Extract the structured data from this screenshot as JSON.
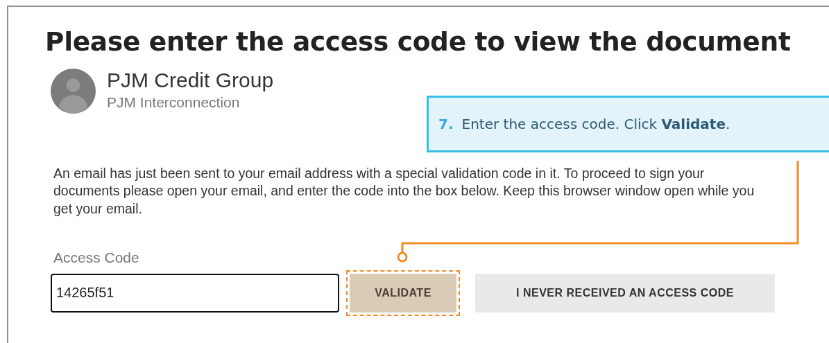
{
  "heading": "Please enter the access code to view the document",
  "sender": {
    "name": "PJM Credit Group",
    "organization": "PJM Interconnection"
  },
  "callout": {
    "step": "7.",
    "text": "Enter the access code. Click **Validate**."
  },
  "message": "An email has just been sent to your email address with a special validation code in it. To proceed to sign your documents please open your email, and enter the code into the box below. Keep this browser window open while you get your email.",
  "access_code": {
    "label": "Access Code",
    "value": "14265f51"
  },
  "buttons": [
    {
      "label": "VALIDATE",
      "kind": "primary",
      "highlighted": true
    },
    {
      "label": "I NEVER RECEIVED AN ACCESS CODE",
      "kind": "secondary",
      "highlighted": false
    }
  ]
}
